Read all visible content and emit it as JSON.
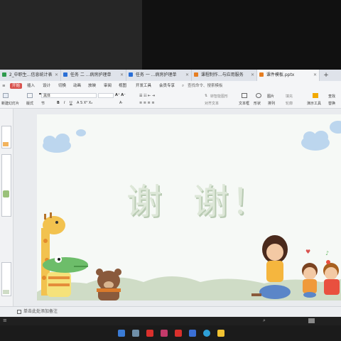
{
  "tabs": [
    {
      "label": "2_中职生...信息统计表",
      "icon_color": "#2e9a4d"
    },
    {
      "label": "任务 二 ...病房护理单",
      "icon_color": "#2a6fd6"
    },
    {
      "label": "任务 一 ...病房护理单",
      "icon_color": "#2a6fd6"
    },
    {
      "label": "课程制作...与应用服务",
      "icon_color": "#e67e22"
    },
    {
      "label": "课件模板.pptx",
      "icon_color": "#e67e22"
    }
  ],
  "tab_add": "+",
  "menu": {
    "start": "开始",
    "items": [
      "插入",
      "设计",
      "切换",
      "动画",
      "放映",
      "审阅",
      "视图",
      "开发工具",
      "会员专享"
    ],
    "search": "查找命令、搜索模板"
  },
  "toolbar": {
    "new_slide": "新建幻灯片",
    "layout": "版式",
    "section": "节",
    "paste": "粘贴",
    "font_box": "黑体",
    "align_text": "对齐文本",
    "text_to_smartart": "转智能图形",
    "textbox": "文本框",
    "shape": "形状",
    "arrange": "排列",
    "picture": "图片",
    "fill": "填充",
    "outline": "轮廓",
    "presenter": "演示工具",
    "replace": "替换",
    "find": "查找"
  },
  "slide": {
    "title": "谢  谢！"
  },
  "statusbar": {
    "text": "单击此处添加备注"
  },
  "colors": {
    "accent": "#d9534f",
    "slide_bg": "#f6f9f6",
    "ground": "#cfdcc6"
  }
}
